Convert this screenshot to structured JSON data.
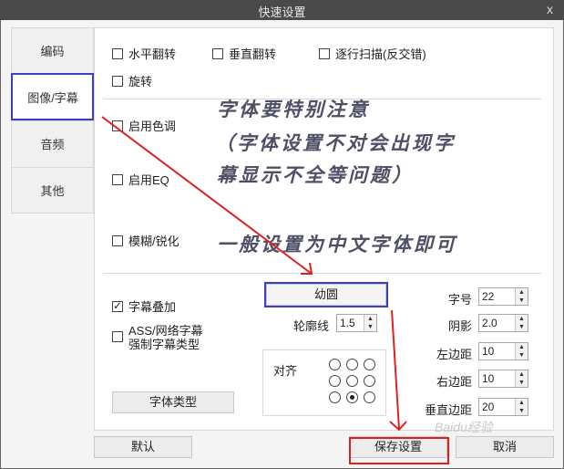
{
  "window": {
    "title": "快速设置",
    "close": "x"
  },
  "tabs": [
    {
      "label": "编码"
    },
    {
      "label": "图像/字幕"
    },
    {
      "label": "音频"
    },
    {
      "label": "其他"
    }
  ],
  "image": {
    "flip_h": "水平翻转",
    "flip_v": "垂直翻转",
    "progressive": "逐行扫描(反交错)",
    "rotate": "旋转",
    "enable_tone": "启用色调",
    "enable_eq": "启用EQ",
    "blur_sharpen": "模糊/锐化"
  },
  "subtitle": {
    "overlay": {
      "label": "字幕叠加",
      "checked": true
    },
    "force_ass_1": "ASS/网络字幕",
    "force_ass_2": "强制字幕类型",
    "font_type_button": "字体类型",
    "font_name": "幼圆",
    "outline_label": "轮廓线",
    "outline_value": "1.5",
    "align_label": "对齐",
    "size_label": "字号",
    "size_value": "22",
    "shadow_label": "阴影",
    "shadow_value": "2.0",
    "left_margin_label": "左边距",
    "left_margin_value": "10",
    "right_margin_label": "右边距",
    "right_margin_value": "10",
    "vertical_margin_label": "垂直边距",
    "vertical_margin_value": "20",
    "align_selected": "bottom-center"
  },
  "footer": {
    "default": "默认",
    "save": "保存设置",
    "cancel": "取消"
  },
  "annotations": {
    "line1": "字体要特别注意",
    "line2": "（字体设置不对会出现字",
    "line3": "幕显示不全等问题）",
    "line4": "一般设置为中文字体即可"
  },
  "watermark": "Baidu经验",
  "colors": {
    "highlight_blue": "#3a40c4",
    "highlight_red": "#e02020",
    "titlebar": "#4a4a4a"
  }
}
